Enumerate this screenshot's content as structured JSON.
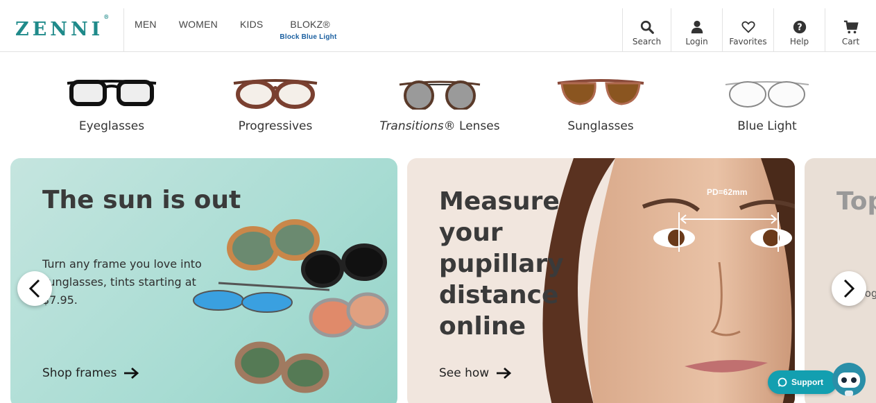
{
  "header": {
    "logo": "ZENNI",
    "logo_mark": "®",
    "nav": [
      {
        "label": "MEN"
      },
      {
        "label": "WOMEN"
      },
      {
        "label": "KIDS"
      },
      {
        "label": "BLOKZ®",
        "sub": "Block Blue Light"
      }
    ],
    "actions": [
      {
        "label": "Search",
        "icon": "search-icon"
      },
      {
        "label": "Login",
        "icon": "user-icon"
      },
      {
        "label": "Favorites",
        "icon": "heart-icon"
      },
      {
        "label": "Help",
        "icon": "help-icon"
      },
      {
        "label": "Cart",
        "icon": "cart-icon"
      }
    ]
  },
  "categories": [
    {
      "label": "Eyeglasses"
    },
    {
      "label": "Progressives"
    },
    {
      "label_italic": "Transitions®",
      "label_rest": " Lenses"
    },
    {
      "label": "Sunglasses"
    },
    {
      "label": "Blue Light"
    }
  ],
  "carousel": {
    "slides": [
      {
        "title": "The sun is out",
        "text": "Turn any frame you love into sunglasses, tints starting at $7.95.",
        "link": "Shop frames"
      },
      {
        "title": "Measure your pupillary distance online",
        "badge": "PD=62mm",
        "link": "See how"
      },
      {
        "title": "Top Pro",
        "text": "Aff progre use."
      }
    ],
    "prev_icon": "chevron-left-icon",
    "next_icon": "chevron-right-icon"
  },
  "support": {
    "label": "Support",
    "icon": "chat-icon"
  },
  "colors": {
    "brand": "#1f8a8a",
    "link_blue": "#1a5fa0",
    "support": "#139fb0",
    "card_teal": "#a8dcd3",
    "card_beige": "#f1e6de"
  }
}
